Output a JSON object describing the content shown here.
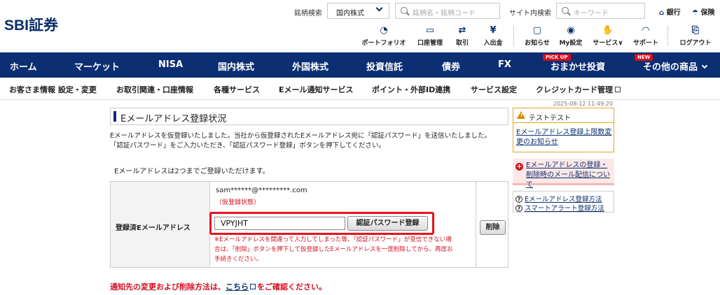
{
  "header": {
    "logo": "SBI証券",
    "stock_search_label": "銘柄検索",
    "market_select": "国内株式",
    "stock_search_placeholder": "銘柄名・銘柄コード",
    "site_search_label": "サイト内検索",
    "site_search_placeholder": "キーワード",
    "bank_link": "銀行",
    "insurance_link": "保険",
    "utility_links": [
      {
        "label": "ポートフォリオ",
        "icon": "portfolio-icon"
      },
      {
        "label": "口座管理",
        "icon": "wallet-icon"
      },
      {
        "label": "取引",
        "icon": "trade-icon"
      },
      {
        "label": "入出金",
        "icon": "yen-transfer-icon"
      },
      {
        "label": "お知らせ",
        "icon": "notice-icon"
      },
      {
        "label": "My設定",
        "icon": "user-settings-icon"
      },
      {
        "label": "サービス",
        "icon": "service-icon"
      },
      {
        "label": "サポート",
        "icon": "headset-icon"
      },
      {
        "label": "ログアウト",
        "icon": "logout-icon"
      }
    ]
  },
  "main_nav": {
    "items": [
      "ホーム",
      "マーケット",
      "NISA",
      "国内株式",
      "外国株式",
      "投資信託",
      "債券",
      "FX",
      "おまかせ投資",
      "その他の商品"
    ],
    "pickup_badge": "PICK UP",
    "new_badge": "NEW"
  },
  "sub_nav": {
    "items": [
      "お客さま情報 設定・変更",
      "お取引関連・口座情報",
      "各種サービス",
      "Eメール通知サービス",
      "ポイント・外部ID連携",
      "サービス設定",
      "クレジットカード管理"
    ]
  },
  "content": {
    "timestamp": "2025-08-12 11:49:20",
    "page_title": "Eメールアドレス登録状況",
    "message_line1": "Eメールアドレスを仮登録いたしました。当社から仮登録されたEメールアドレス宛に「認証パスワード」を送信いたしました。",
    "message_line2": "「認証パスワード」をご入力いただき、「認証パスワード登録」ボタンを押下してください。",
    "limit_note": "Eメールアドレスは2つまでご登録いただけます。",
    "table": {
      "header": "登録済Eメールアドレス",
      "email": "sam******@*********.com",
      "status": "（仮登録状態）",
      "code_value": "VPYJHT",
      "register_button": "認証パスワード登録",
      "delete_button": "削除",
      "warning_line1": "※Eメールアドレスを間違って入力してしまった等、「認証パスワード」が受信できない場",
      "warning_line2": "合は、「削除」ボタンを押下して仮登録したEメールアドレスを一度削除してから、再度お",
      "warning_line3": "手続きください。"
    },
    "notice_prefix": "通知先の変更および削除方法は、",
    "notice_link": "こちら",
    "notice_suffix": "をご確認ください。"
  },
  "sidebar": {
    "test_title": "テストテスト",
    "test_link": "Eメールアドレス登録上限数変更のお知らせ",
    "alert_link": "Eメールアドレスの登録・削除時のメール配信について",
    "help_links": [
      "Eメールアドレス登録方法",
      "スマートアラート登録方法"
    ]
  },
  "colors": {
    "navy": "#0c2e73",
    "red": "#e8141c",
    "orange_border": "#e3a628"
  }
}
